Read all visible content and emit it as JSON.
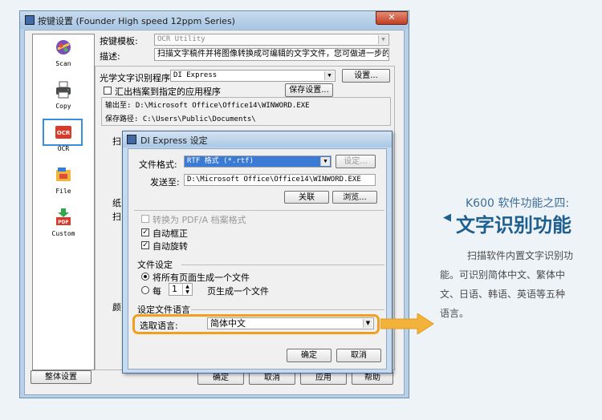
{
  "main_window": {
    "title": "按键设置 (Founder High speed 12ppm Series)",
    "close_glyph": "✕"
  },
  "sidebar": {
    "items": [
      {
        "label": "Scan",
        "icon": "scan-icon"
      },
      {
        "label": "Copy",
        "icon": "printer-icon"
      },
      {
        "label": "OCR",
        "icon": "ocr-icon"
      },
      {
        "label": "File",
        "icon": "file-icon"
      },
      {
        "label": "Custom",
        "icon": "pdf-icon"
      }
    ],
    "ocr_icon_text": "OCR",
    "pdf_icon_text": "PDF",
    "global_settings_button": "整体设置"
  },
  "settings": {
    "template_label": "按键模板:",
    "template_value": "OCR Utility",
    "description_label": "描述:",
    "description_value": "扫描文字稿件并将图像转换成可编辑的文字文件，您可做进一步的浏览、",
    "ocr_program_label": "光学文字识别程序:",
    "ocr_program_value": "DI Express",
    "settings_button": "设置...",
    "export_checkbox_label": "汇出档案到指定的应用程序",
    "save_settings_button": "保存设置...",
    "output_to": "输出至: D:\\Microsoft Office\\Office14\\WINWORD.EXE",
    "save_path": "保存路径: C:\\Users\\Public\\Documents\\",
    "partial_1": "扫",
    "partial_2": "纸",
    "partial_3": "扫",
    "partial_4": "颜"
  },
  "footer_buttons": {
    "ok": "确定",
    "cancel": "取消",
    "apply": "应用",
    "help": "帮助"
  },
  "dialog": {
    "title": "DI Express 设定",
    "file_format_label": "文件格式:",
    "file_format_value": "RTF 格式 (*.rtf)",
    "format_settings_button": "设定...",
    "send_to_label": "发送至:",
    "send_to_value": "D:\\Microsoft Office\\Office14\\WINWORD.EXE",
    "link_button": "关联",
    "browse_button": "浏览...",
    "convert_pdfa_label": "转换为 PDF/A 档案格式",
    "auto_deskew_label": "自动框正",
    "auto_rotate_label": "自动旋转",
    "file_settings_header": "文件设定",
    "all_pages_label": "将所有页面生成一个文件",
    "every_label": "每",
    "pages_value": "1",
    "per_file_label": "页生成一个文件",
    "language_header": "设定文件语言",
    "select_language_label": "选取语言:",
    "language_value": "简体中文",
    "ok_button": "确定",
    "cancel_button": "取消"
  },
  "feature": {
    "subtitle": "K600 软件功能之四:",
    "title": "文字识别功能",
    "description_lines": [
      "扫描软件内置文字识别功",
      "能。可识别简体中文、繁体中",
      "文、日语、韩语、英语等五种",
      "语言。"
    ],
    "title_color": "#1f5f8e",
    "highlight_color": "#f0a020"
  }
}
